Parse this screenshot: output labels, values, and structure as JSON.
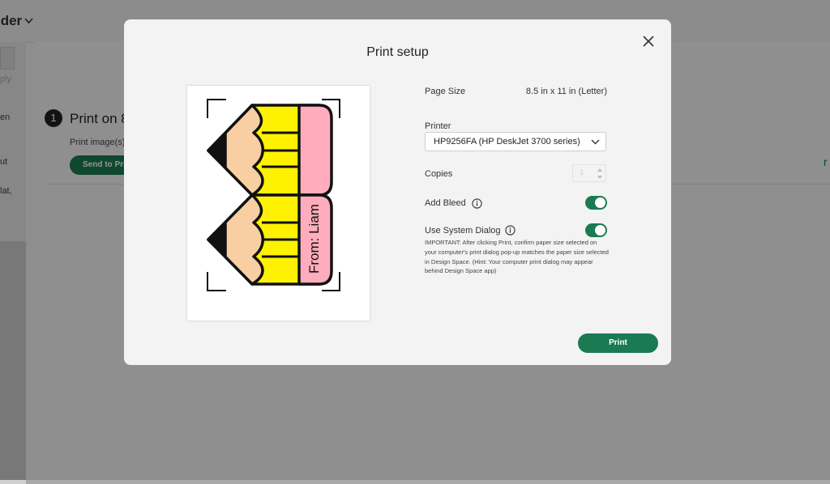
{
  "background": {
    "header_title": "lder",
    "left_fragments": [
      "ply",
      "en",
      "ut",
      "lat,"
    ],
    "step_number": "1",
    "step_title": "Print on 8",
    "step_subtitle": "Print image(s)",
    "send_button": "Send to Prin",
    "right_fragment": "r"
  },
  "dialog": {
    "title": "Print setup",
    "page_size_label": "Page Size",
    "page_size_value": "8.5 in x 11 in (Letter)",
    "printer_label": "Printer",
    "printer_value": "HP9256FA (HP DeskJet 3700 series)",
    "copies_label": "Copies",
    "copies_value": "1",
    "add_bleed_label": "Add Bleed",
    "add_bleed_on": true,
    "system_dialog_label": "Use System Dialog",
    "system_dialog_on": true,
    "important_note": "IMPORTANT: After clicking Print, confirm paper size selected on your computer's print dialog pop-up matches the paper size selected in Design Space. (Hint: Your computer print dialog may appear behind Design Space app)",
    "print_button": "Print"
  },
  "preview": {
    "label_text": "From: Liam"
  },
  "colors": {
    "accent": "#1a7a52",
    "pencil_yellow": "#fff200",
    "pencil_wood": "#f8cfa3",
    "pencil_eraser": "#ffadbd"
  }
}
